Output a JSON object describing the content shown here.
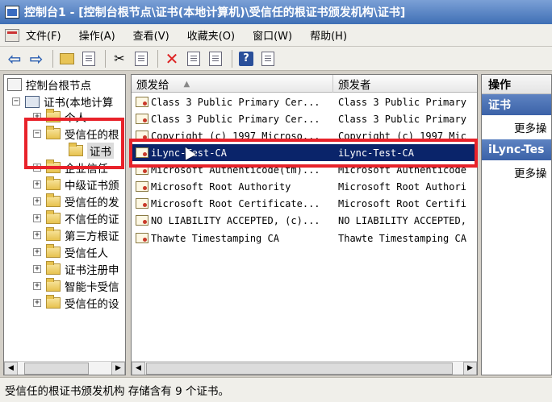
{
  "window": {
    "title": "控制台1 - [控制台根节点\\证书(本地计算机)\\受信任的根证书颁发机构\\证书]"
  },
  "menu": {
    "items": [
      "文件(F)",
      "操作(A)",
      "查看(V)",
      "收藏夹(O)",
      "窗口(W)",
      "帮助(H)"
    ]
  },
  "tree": {
    "root": "控制台根节点",
    "store": "证书(本地计算",
    "items": [
      {
        "label": "个人",
        "expander": "+"
      },
      {
        "label": "受信任的根",
        "expander": "−"
      },
      {
        "label": "证书",
        "expander": ""
      },
      {
        "label": "企业信任",
        "expander": "+"
      },
      {
        "label": "中级证书颁",
        "expander": "+"
      },
      {
        "label": "受信任的发",
        "expander": "+"
      },
      {
        "label": "不信任的证",
        "expander": "+"
      },
      {
        "label": "第三方根证",
        "expander": "+"
      },
      {
        "label": "受信任人",
        "expander": "+"
      },
      {
        "label": "证书注册申",
        "expander": "+"
      },
      {
        "label": "智能卡受信",
        "expander": "+"
      },
      {
        "label": "受信任的设",
        "expander": "+"
      }
    ]
  },
  "list": {
    "columns": {
      "issued_to": "颁发给",
      "issued_by": "颁发者"
    },
    "rows": [
      {
        "issued_to": "Class 3 Public Primary Cer...",
        "issued_by": "Class 3 Public Primary"
      },
      {
        "issued_to": "Class 3 Public Primary Cer...",
        "issued_by": "Class 3 Public Primary"
      },
      {
        "issued_to": "Copyright (c) 1997 Microso...",
        "issued_by": "Copyright (c) 1997 Mic"
      },
      {
        "issued_to": "iLync-Test-CA",
        "issued_by": "iLync-Test-CA"
      },
      {
        "issued_to": "Microsoft Authenticode(tm)...",
        "issued_by": "Microsoft Authenticode"
      },
      {
        "issued_to": "Microsoft Root Authority",
        "issued_by": "Microsoft Root Authori"
      },
      {
        "issued_to": "Microsoft Root Certificate...",
        "issued_by": "Microsoft Root Certifi"
      },
      {
        "issued_to": "NO LIABILITY ACCEPTED, (c)...",
        "issued_by": "NO LIABILITY ACCEPTED,"
      },
      {
        "issued_to": "Thawte Timestamping CA",
        "issued_by": "Thawte Timestamping CA"
      }
    ]
  },
  "actions": {
    "header": "操作",
    "sections": [
      {
        "title": "证书",
        "link": "更多操"
      },
      {
        "title": "iLync-Tes",
        "link": "更多操"
      }
    ]
  },
  "status": {
    "text": "受信任的根证书颁发机构 存储含有 9 个证书。"
  }
}
